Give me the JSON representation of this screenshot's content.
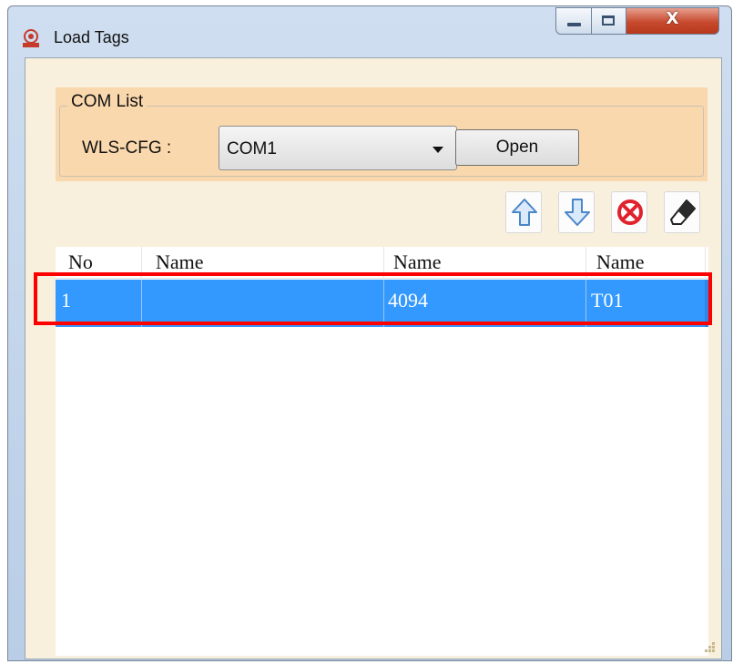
{
  "window": {
    "title": "Load Tags",
    "close_glyph": "X"
  },
  "com_list": {
    "legend": "COM List",
    "label": "WLS-CFG :",
    "selected": "COM1",
    "open_label": "Open"
  },
  "toolbar": {
    "icons": [
      "arrow-up-icon",
      "arrow-down-icon",
      "delete-icon",
      "eraser-icon"
    ]
  },
  "table": {
    "headers": [
      "No",
      "Name",
      "Name",
      "Name"
    ],
    "rows": [
      [
        "1",
        "",
        "4094",
        "T01"
      ]
    ]
  },
  "colors": {
    "selection": "#3399ff",
    "highlight_border": "#ff0000",
    "com_panel": "#fad8ad",
    "client_bg": "#f8f0dc"
  }
}
